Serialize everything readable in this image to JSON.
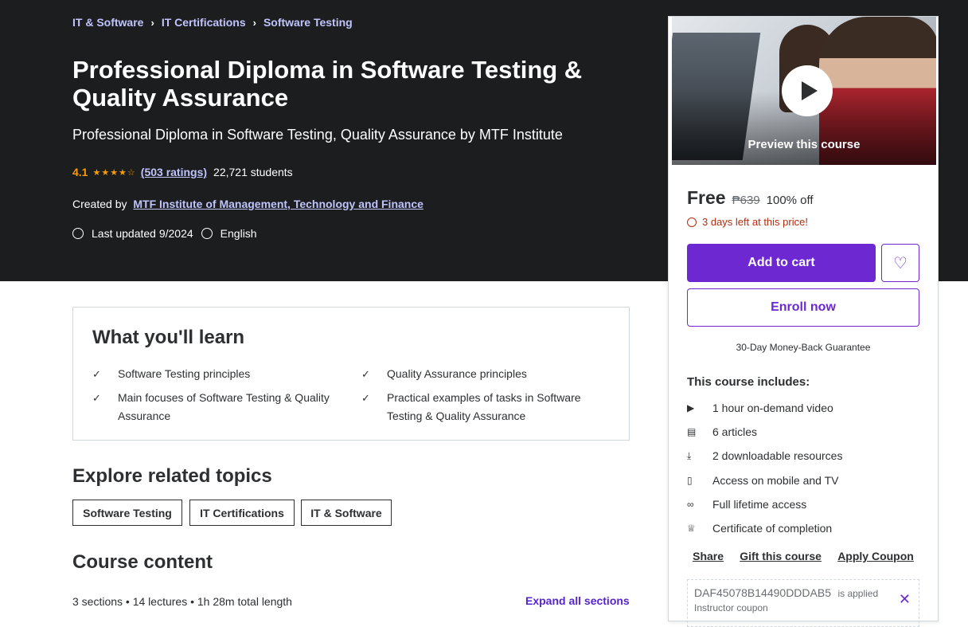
{
  "breadcrumb": [
    "IT & Software",
    "IT Certifications",
    "Software Testing"
  ],
  "course": {
    "title": "Professional Diploma in Software Testing & Quality Assurance",
    "subtitle": "Professional Diploma in Software Testing, Quality Assurance by MTF Institute",
    "rating": "4.1",
    "ratings_link": "(503 ratings)",
    "students": "22,721 students",
    "created_by_label": "Created by",
    "author": "MTF Institute of Management, Technology and Finance",
    "last_updated": "Last updated 9/2024",
    "language": "English"
  },
  "learn": {
    "title": "What you'll learn",
    "items": [
      "Software Testing principles",
      "Quality Assurance principles",
      "Main focuses of Software Testing & Quality Assurance",
      "Practical examples of tasks in Software Testing & Quality Assurance"
    ]
  },
  "topics": {
    "title": "Explore related topics",
    "items": [
      "Software Testing",
      "IT Certifications",
      "IT & Software"
    ]
  },
  "content": {
    "title": "Course content",
    "meta": "3 sections • 14 lectures • 1h 28m total length",
    "expand": "Expand all sections"
  },
  "sidebar": {
    "preview_label": "Preview this course",
    "price": "Free",
    "old_price": "₱639",
    "discount": "100% off",
    "timer": "3 days left at this price!",
    "add_to_cart": "Add to cart",
    "enroll": "Enroll now",
    "guarantee": "30-Day Money-Back Guarantee",
    "includes_title": "This course includes:",
    "includes": [
      {
        "icon": "video-icon",
        "label": "1 hour on-demand video"
      },
      {
        "icon": "article-icon",
        "label": "6 articles"
      },
      {
        "icon": "download-icon",
        "label": "2 downloadable resources"
      },
      {
        "icon": "mobile-icon",
        "label": "Access on mobile and TV"
      },
      {
        "icon": "infinity-icon",
        "label": "Full lifetime access"
      },
      {
        "icon": "trophy-icon",
        "label": "Certificate of completion"
      }
    ],
    "actions": [
      "Share",
      "Gift this course",
      "Apply Coupon"
    ],
    "coupon_code": "DAF45078B14490DDDAB5",
    "coupon_applied": "is applied",
    "coupon_sub": "Instructor coupon"
  },
  "colors": {
    "hero_bg": "#1c1d1f",
    "link_light": "#c0c4fc",
    "star": "#f69c08",
    "primary": "#6d28d2",
    "alert": "#b32d0f"
  }
}
